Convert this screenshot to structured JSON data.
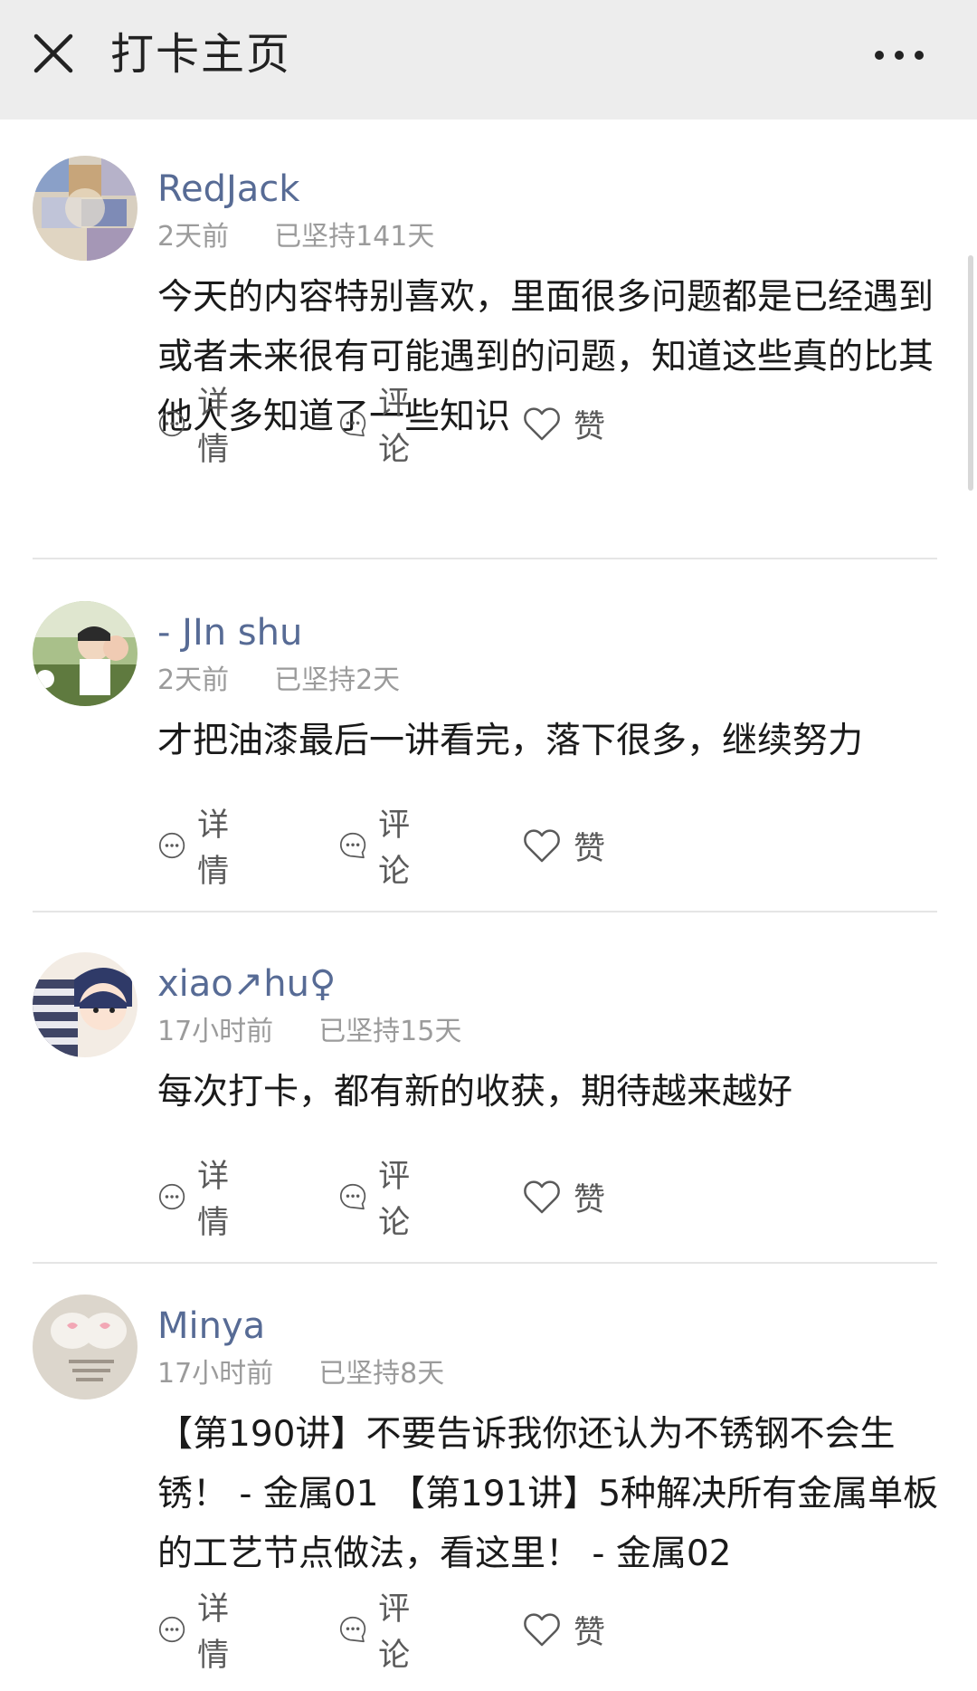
{
  "header": {
    "title": "打卡主页",
    "close_icon": "close-icon",
    "more_icon": "more-horizontal-icon"
  },
  "colors": {
    "username": "#576b95",
    "meta": "#9b9b9b",
    "content": "#1a1a1a",
    "header_bg": "#ededed"
  },
  "posts": [
    {
      "username": "RedJack",
      "time": "2天前",
      "streak": "已坚持141天",
      "content": "今天的内容特别喜欢，里面很多问题都是已经遇到或者未来很有可能遇到的问题，知道这些真的比其他人多知道了一些知识",
      "actions": {
        "detail": "详情",
        "comment": "评论",
        "like": "赞"
      }
    },
    {
      "username": "- JIn shu",
      "time": "2天前",
      "streak": "已坚持2天",
      "content": "才把油漆最后一讲看完，落下很多，继续努力",
      "actions": {
        "detail": "详情",
        "comment": "评论",
        "like": "赞"
      }
    },
    {
      "username": "xiao↗hu♀",
      "time": "17小时前",
      "streak": "已坚持15天",
      "content": "每次打卡，都有新的收获，期待越来越好",
      "actions": {
        "detail": "详情",
        "comment": "评论",
        "like": "赞"
      }
    },
    {
      "username": "Minya",
      "time": "17小时前",
      "streak": "已坚持8天",
      "content": "【第190讲】不要告诉我你还认为不锈钢不会生锈！ - 金属01 【第191讲】5种解决所有金属单板的工艺节点做法，看这里！ - 金属02",
      "actions": {
        "detail": "详情",
        "comment": "评论",
        "like": "赞"
      }
    }
  ]
}
